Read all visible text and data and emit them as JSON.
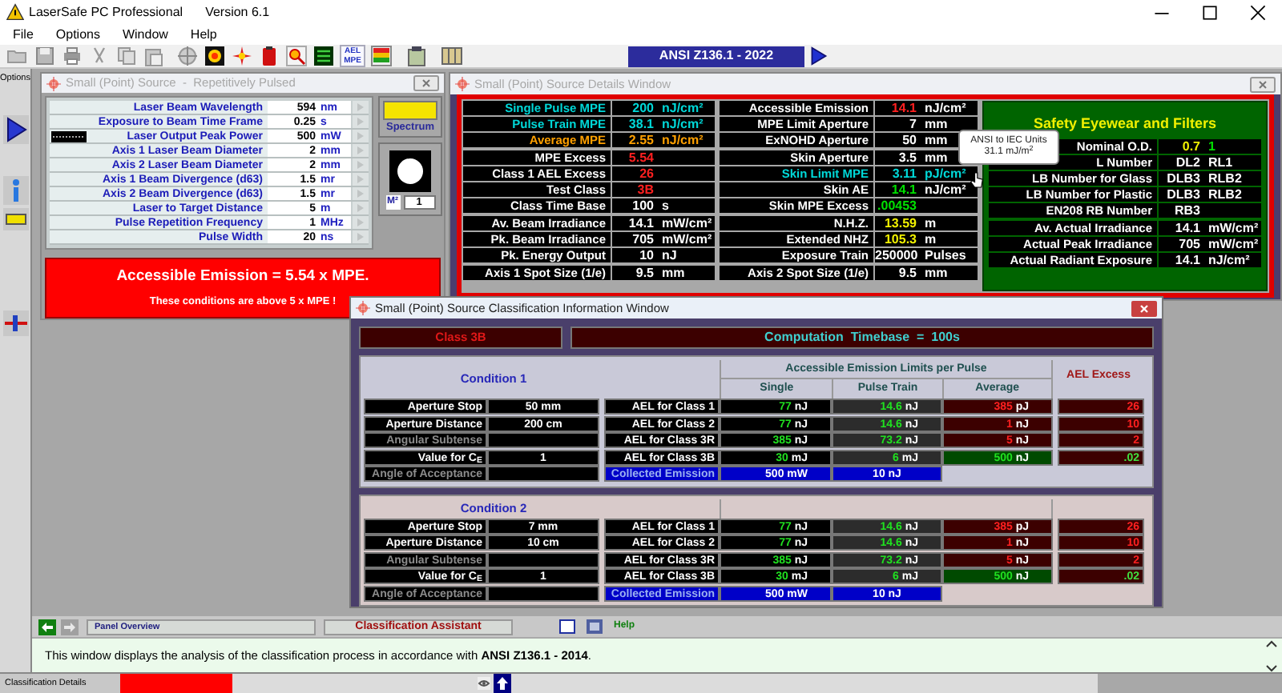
{
  "app": {
    "title": "LaserSafe PC Professional",
    "version": "Version 6.1"
  },
  "menu": [
    "File",
    "Options",
    "Window",
    "Help"
  ],
  "toolbar": {
    "ael_label": "AEL MPE",
    "standard": "ANSI Z136.1 - 2022"
  },
  "sidebar": {
    "label": "Options"
  },
  "source_window": {
    "title": "Small (Point) Source  -  Repetitively Pulsed",
    "parameters": [
      {
        "label": "Laser Beam Wavelength",
        "value": "594",
        "unit": "nm",
        "waveform": false
      },
      {
        "label": "Exposure to Beam Time Frame",
        "value": "0.25",
        "unit": "s",
        "waveform": false
      },
      {
        "label": "Laser Output Peak Power",
        "value": "500",
        "unit": "mW",
        "waveform": true
      },
      {
        "label": "Axis 1 Laser Beam Diameter",
        "value": "2",
        "unit": "mm",
        "waveform": false
      },
      {
        "label": "Axis 2 Laser Beam Diameter",
        "value": "2",
        "unit": "mm",
        "waveform": false
      },
      {
        "label": "Axis 1 Beam Divergence (d63)",
        "value": "1.5",
        "unit": "mr",
        "waveform": false
      },
      {
        "label": "Axis 2 Beam Divergence (d63)",
        "value": "1.5",
        "unit": "mr",
        "waveform": false
      },
      {
        "label": "Laser to Target Distance",
        "value": "5",
        "unit": "m",
        "waveform": false
      },
      {
        "label": "Pulse Repetition Frequency",
        "value": "1",
        "unit": "MHz",
        "waveform": false
      },
      {
        "label": "Pulse Width",
        "value": "20",
        "unit": "ns",
        "waveform": false
      }
    ],
    "spectrum_label": "Spectrum",
    "m2_label": "M²",
    "m2_value": "1",
    "alert": {
      "headline": "Accessible Emission = 5.54 x MPE.",
      "detail": "These conditions are above 5 x MPE !"
    }
  },
  "details_window": {
    "title": "Small (Point) Source Details Window",
    "tables": [
      {
        "groups": [
          [
            {
              "label": {
                "text": "Single Pulse MPE",
                "kind": "limit"
              },
              "cells": [
                {
                  "text": "200",
                  "kind": "limit"
                },
                {
                  "text": "nJ/cm²",
                  "kind": "limit"
                }
              ]
            },
            {
              "label": {
                "text": "Pulse Train MPE",
                "kind": "limit"
              },
              "cells": [
                {
                  "text": "38.1",
                  "kind": "limit"
                },
                {
                  "text": "nJ/cm²",
                  "kind": "limit"
                }
              ]
            },
            {
              "label": {
                "text": "Average MPE",
                "kind": "average"
              },
              "cells": [
                {
                  "text": "2.55",
                  "kind": "average"
                },
                {
                  "text": "nJ/cm²",
                  "kind": "average"
                }
              ]
            }
          ],
          [
            {
              "label": {
                "text": "MPE Excess",
                "kind": "plain"
              },
              "cells": [
                {
                  "text": "5.54",
                  "kind": "alert"
                }
              ]
            },
            {
              "label": {
                "text": "Class 1 AEL Excess",
                "kind": "plain"
              },
              "cells": [
                {
                  "text": "26",
                  "kind": "alert"
                }
              ]
            },
            {
              "label": {
                "text": "Test Class",
                "kind": "plain"
              },
              "cells": [
                {
                  "text": "3B",
                  "kind": "alert"
                }
              ]
            },
            {
              "label": {
                "text": "Class Time Base",
                "kind": "plain"
              },
              "cells": [
                {
                  "text": "100",
                  "kind": "plain"
                },
                {
                  "text": "s",
                  "kind": "plain"
                }
              ]
            }
          ],
          [
            {
              "label": {
                "text": "Av. Beam Irradiance",
                "kind": "plain"
              },
              "cells": [
                {
                  "text": "14.1",
                  "kind": "plain"
                },
                {
                  "text": "mW/cm²",
                  "kind": "plain"
                }
              ]
            },
            {
              "label": {
                "text": "Pk. Beam Irradiance",
                "kind": "plain"
              },
              "cells": [
                {
                  "text": "705",
                  "kind": "plain"
                },
                {
                  "text": "mW/cm²",
                  "kind": "plain"
                }
              ]
            },
            {
              "label": {
                "text": "Pk. Energy Output",
                "kind": "plain"
              },
              "cells": [
                {
                  "text": "10",
                  "kind": "plain"
                },
                {
                  "text": "nJ",
                  "kind": "plain"
                }
              ]
            }
          ],
          [
            {
              "label": {
                "text": "Axis 1 Spot Size  (1/e)",
                "kind": "plain"
              },
              "cells": [
                {
                  "text": "9.5",
                  "kind": "plain"
                },
                {
                  "text": "mm",
                  "kind": "plain"
                }
              ]
            }
          ]
        ]
      },
      {
        "groups": [
          [
            {
              "label": {
                "text": "Accessible Emission",
                "kind": "plain"
              },
              "cells": [
                {
                  "text": "14.1",
                  "kind": "alert"
                },
                {
                  "text": "nJ/cm²",
                  "kind": "plain"
                }
              ]
            },
            {
              "label": {
                "text": "MPE Limit Aperture",
                "kind": "plain"
              },
              "cells": [
                {
                  "text": "7",
                  "kind": "plain"
                },
                {
                  "text": "mm",
                  "kind": "plain"
                }
              ]
            },
            {
              "label": {
                "text": "ExNOHD Aperture",
                "kind": "plain"
              },
              "cells": [
                {
                  "text": "50",
                  "kind": "plain"
                },
                {
                  "text": "mm",
                  "kind": "plain"
                }
              ]
            }
          ],
          [
            {
              "label": {
                "text": "Skin Aperture",
                "kind": "plain"
              },
              "cells": [
                {
                  "text": "3.5",
                  "kind": "plain"
                },
                {
                  "text": "mm",
                  "kind": "plain"
                }
              ]
            },
            {
              "label": {
                "text": "Skin Limit MPE",
                "kind": "limit"
              },
              "cells": [
                {
                  "text": "3.11",
                  "kind": "limit"
                },
                {
                  "text": "pJ/cm²",
                  "kind": "limit"
                }
              ]
            },
            {
              "label": {
                "text": "Skin AE",
                "kind": "plain"
              },
              "cells": [
                {
                  "text": "14.1",
                  "kind": "safe"
                },
                {
                  "text": "nJ/cm²",
                  "kind": "plain"
                }
              ]
            },
            {
              "label": {
                "text": "Skin MPE Excess",
                "kind": "plain"
              },
              "cells": [
                {
                  "text": ".00453",
                  "kind": "safe"
                }
              ]
            }
          ],
          [
            {
              "label": {
                "text": "N.H.Z.",
                "kind": "plain"
              },
              "cells": [
                {
                  "text": "13.59",
                  "kind": "notice"
                },
                {
                  "text": "m",
                  "kind": "plain"
                }
              ]
            },
            {
              "label": {
                "text": "Extended NHZ",
                "kind": "plain"
              },
              "cells": [
                {
                  "text": "105.3",
                  "kind": "notice"
                },
                {
                  "text": "m",
                  "kind": "plain"
                }
              ]
            },
            {
              "label": {
                "text": "Exposure Train",
                "kind": "plain"
              },
              "cells": [
                {
                  "text": "250000",
                  "kind": "plain"
                },
                {
                  "text": "Pulses",
                  "kind": "plain"
                }
              ]
            }
          ],
          [
            {
              "label": {
                "text": "Axis 2 Spot Size  (1/e)",
                "kind": "plain"
              },
              "cells": [
                {
                  "text": "9.5",
                  "kind": "plain"
                },
                {
                  "text": "mm",
                  "kind": "plain"
                }
              ]
            }
          ]
        ]
      }
    ],
    "eyewear": {
      "title": "Safety Eyewear and Filters",
      "groups": [
        [
          {
            "label": {
              "text": "Nominal O.D.",
              "kind": "plain"
            },
            "cells": [
              {
                "text": "0.7",
                "kind": "notice"
              },
              {
                "text": "1",
                "kind": "safe"
              }
            ]
          },
          {
            "label": {
              "text": "L Number",
              "kind": "plain"
            },
            "cells": [
              {
                "text": "DL2",
                "kind": "plain"
              },
              {
                "text": "RL1",
                "kind": "plain"
              }
            ]
          },
          {
            "label": {
              "text": "LB Number for Glass",
              "kind": "plain"
            },
            "cells": [
              {
                "text": "DLB3",
                "kind": "plain"
              },
              {
                "text": "RLB2",
                "kind": "plain"
              }
            ]
          },
          {
            "label": {
              "text": "LB Number for Plastic",
              "kind": "plain"
            },
            "cells": [
              {
                "text": "DLB3",
                "kind": "plain"
              },
              {
                "text": "RLB2",
                "kind": "plain"
              }
            ]
          },
          {
            "label": {
              "text": "EN208 RB Number",
              "kind": "plain"
            },
            "cells": [
              {
                "text": "RB3",
                "kind": "plain"
              }
            ]
          }
        ],
        [
          {
            "label": {
              "text": "Av. Actual Irradiance",
              "kind": "plain"
            },
            "cells": [
              {
                "text": "14.1",
                "kind": "plain"
              },
              {
                "text": "mW/cm²",
                "kind": "plain"
              }
            ]
          },
          {
            "label": {
              "text": "Actual Peak Irradiance",
              "kind": "plain"
            },
            "cells": [
              {
                "text": "705",
                "kind": "plain"
              },
              {
                "text": "mW/cm²",
                "kind": "plain"
              }
            ]
          },
          {
            "label": {
              "text": "Actual Radiant Exposure",
              "kind": "plain"
            },
            "cells": [
              {
                "text": "14.1",
                "kind": "plain"
              },
              {
                "text": "nJ/cm²",
                "kind": "plain"
              }
            ]
          }
        ]
      ]
    },
    "tooltip": {
      "title": "ANSI to IEC Units",
      "text": "31.1 mJ/m$^{2}$"
    }
  },
  "classification_window": {
    "title": "Small (Point) Source Classification Information Window",
    "class_label": "Class 3B",
    "timebase": "Computation  Timebase  =  100s",
    "limits_header": "Accessible Emission Limits per Pulse",
    "columns": [
      "Single",
      "Pulse Train",
      "Average"
    ],
    "excess_header": "AEL Excess",
    "conditions": [
      {
        "title": "Condition 1",
        "parameters": [
          {
            "label": "Aperture Stop",
            "value": "50 mm",
            "enabled": true
          },
          {
            "label": "Aperture Distance",
            "value": "200 cm",
            "enabled": true
          },
          {
            "label": "Angular Subtense",
            "enabled": false
          },
          {
            "label": "Value for C$_{E}$",
            "value": "1",
            "enabled": true
          },
          {
            "label": "Angle of Acceptance",
            "enabled": false
          }
        ],
        "limits": [
          {
            "label": "AEL for Class 1",
            "single": "77 nJ",
            "pulse_train": "14.6 nJ",
            "average": "385 pJ",
            "excess": "26",
            "passed": false
          },
          {
            "label": "AEL for Class 2",
            "single": "77 nJ",
            "pulse_train": "14.6 nJ",
            "average": "1 nJ",
            "excess": "10",
            "passed": false
          },
          {
            "label": "AEL for Class 3R",
            "single": "385 nJ",
            "pulse_train": "73.2 nJ",
            "average": "5 nJ",
            "excess": "2",
            "passed": false
          },
          {
            "label": "AEL for Class 3B",
            "single": "30 mJ",
            "pulse_train": "6 mJ",
            "average": "500 nJ",
            "excess": ".02",
            "passed": true
          }
        ],
        "collected": {
          "label": "Collected Emission",
          "single": "500 mW",
          "pulse_train": "10 nJ"
        }
      },
      {
        "title": "Condition 2",
        "parameters": [
          {
            "label": "Aperture Stop",
            "value": "7 mm",
            "enabled": true
          },
          {
            "label": "Aperture Distance",
            "value": "10 cm",
            "enabled": true
          },
          {
            "label": "Angular Subtense",
            "enabled": false
          },
          {
            "label": "Value for C$_{E}$",
            "value": "1",
            "enabled": true
          },
          {
            "label": "Angle of Acceptance",
            "enabled": false
          }
        ],
        "limits": [
          {
            "label": "AEL for Class 1",
            "single": "77 nJ",
            "pulse_train": "14.6 nJ",
            "average": "385 pJ",
            "excess": "26",
            "passed": false
          },
          {
            "label": "AEL for Class 2",
            "single": "77 nJ",
            "pulse_train": "14.6 nJ",
            "average": "1 nJ",
            "excess": "10",
            "passed": false
          },
          {
            "label": "AEL for Class 3R",
            "single": "385 nJ",
            "pulse_train": "73.2 nJ",
            "average": "5 nJ",
            "excess": "2",
            "passed": false
          },
          {
            "label": "AEL for Class 3B",
            "single": "30 mJ",
            "pulse_train": "6 mJ",
            "average": "500 nJ",
            "excess": ".02",
            "passed": true
          }
        ],
        "collected": {
          "label": "Collected Emission",
          "single": "500 mW",
          "pulse_train": "10 nJ"
        }
      }
    ]
  },
  "panel_bar": {
    "panel": "Panel Overview",
    "assistant": "Classification Assistant",
    "help": "Help"
  },
  "message": "This window displays the analysis of the classification process in accordance with **ANSI Z136.1 - 2014**.",
  "status_bar": {
    "label": "Classification Details"
  }
}
